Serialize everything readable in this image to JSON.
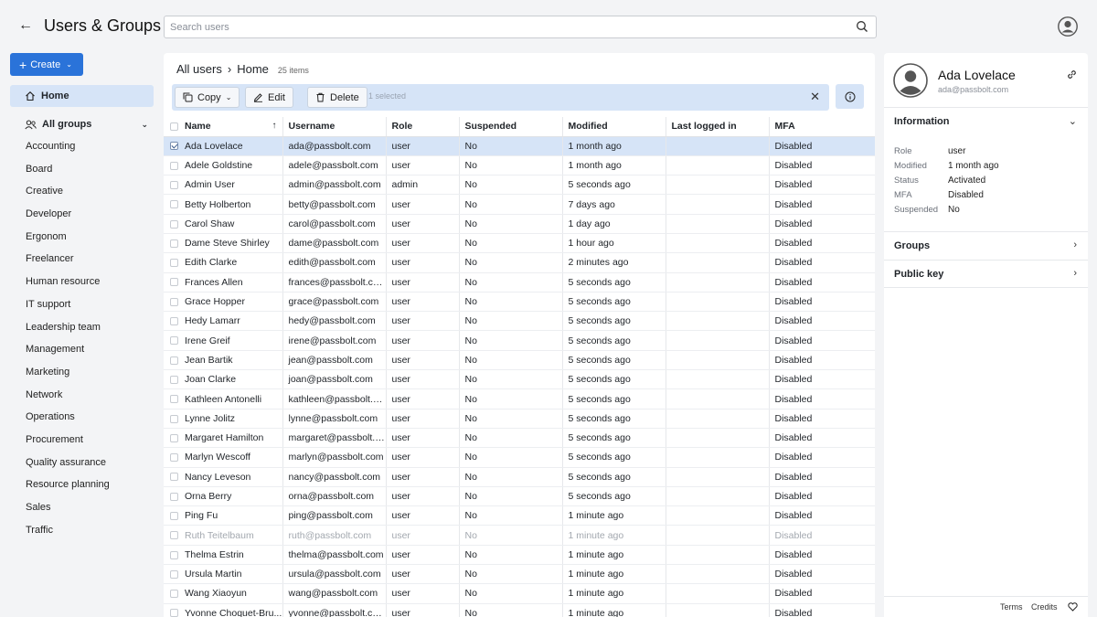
{
  "header": {
    "title": "Users & Groups",
    "search_placeholder": "Search users"
  },
  "sidebar": {
    "create_label": "Create",
    "home_label": "Home",
    "all_groups_label": "All groups",
    "groups": [
      "Accounting",
      "Board",
      "Creative",
      "Developer",
      "Ergonom",
      "Freelancer",
      "Human resource",
      "IT support",
      "Leadership team",
      "Management",
      "Marketing",
      "Network",
      "Operations",
      "Procurement",
      "Quality assurance",
      "Resource planning",
      "Sales",
      "Traffic"
    ]
  },
  "breadcrumb": {
    "root": "All users",
    "separator": "›",
    "current": "Home",
    "count": "25 items"
  },
  "actions": {
    "copy": "Copy",
    "edit": "Edit",
    "delete": "Delete",
    "selected": "1 selected"
  },
  "table": {
    "columns": [
      "Name",
      "Username",
      "Role",
      "Suspended",
      "Modified",
      "Last logged in",
      "MFA"
    ],
    "rows": [
      {
        "name": "Ada Lovelace",
        "username": "ada@passbolt.com",
        "role": "user",
        "suspended": "No",
        "modified": "1 month ago",
        "last": "",
        "mfa": "Disabled",
        "selected": true
      },
      {
        "name": "Adele Goldstine",
        "username": "adele@passbolt.com",
        "role": "user",
        "suspended": "No",
        "modified": "1 month ago",
        "last": "",
        "mfa": "Disabled"
      },
      {
        "name": "Admin User",
        "username": "admin@passbolt.com",
        "role": "admin",
        "suspended": "No",
        "modified": "5 seconds ago",
        "last": "",
        "mfa": "Disabled"
      },
      {
        "name": "Betty Holberton",
        "username": "betty@passbolt.com",
        "role": "user",
        "suspended": "No",
        "modified": "7 days ago",
        "last": "",
        "mfa": "Disabled"
      },
      {
        "name": "Carol Shaw",
        "username": "carol@passbolt.com",
        "role": "user",
        "suspended": "No",
        "modified": "1 day ago",
        "last": "",
        "mfa": "Disabled"
      },
      {
        "name": "Dame Steve Shirley",
        "username": "dame@passbolt.com",
        "role": "user",
        "suspended": "No",
        "modified": "1 hour ago",
        "last": "",
        "mfa": "Disabled"
      },
      {
        "name": "Edith Clarke",
        "username": "edith@passbolt.com",
        "role": "user",
        "suspended": "No",
        "modified": "2 minutes ago",
        "last": "",
        "mfa": "Disabled"
      },
      {
        "name": "Frances Allen",
        "username": "frances@passbolt.com",
        "role": "user",
        "suspended": "No",
        "modified": "5 seconds ago",
        "last": "",
        "mfa": "Disabled"
      },
      {
        "name": "Grace Hopper",
        "username": "grace@passbolt.com",
        "role": "user",
        "suspended": "No",
        "modified": "5 seconds ago",
        "last": "",
        "mfa": "Disabled"
      },
      {
        "name": "Hedy Lamarr",
        "username": "hedy@passbolt.com",
        "role": "user",
        "suspended": "No",
        "modified": "5 seconds ago",
        "last": "",
        "mfa": "Disabled"
      },
      {
        "name": "Irene Greif",
        "username": "irene@passbolt.com",
        "role": "user",
        "suspended": "No",
        "modified": "5 seconds ago",
        "last": "",
        "mfa": "Disabled"
      },
      {
        "name": "Jean Bartik",
        "username": "jean@passbolt.com",
        "role": "user",
        "suspended": "No",
        "modified": "5 seconds ago",
        "last": "",
        "mfa": "Disabled"
      },
      {
        "name": "Joan Clarke",
        "username": "joan@passbolt.com",
        "role": "user",
        "suspended": "No",
        "modified": "5 seconds ago",
        "last": "",
        "mfa": "Disabled"
      },
      {
        "name": "Kathleen Antonelli",
        "username": "kathleen@passbolt.c...",
        "role": "user",
        "suspended": "No",
        "modified": "5 seconds ago",
        "last": "",
        "mfa": "Disabled"
      },
      {
        "name": "Lynne Jolitz",
        "username": "lynne@passbolt.com",
        "role": "user",
        "suspended": "No",
        "modified": "5 seconds ago",
        "last": "",
        "mfa": "Disabled"
      },
      {
        "name": "Margaret Hamilton",
        "username": "margaret@passbolt.c...",
        "role": "user",
        "suspended": "No",
        "modified": "5 seconds ago",
        "last": "",
        "mfa": "Disabled"
      },
      {
        "name": "Marlyn Wescoff",
        "username": "marlyn@passbolt.com",
        "role": "user",
        "suspended": "No",
        "modified": "5 seconds ago",
        "last": "",
        "mfa": "Disabled"
      },
      {
        "name": "Nancy Leveson",
        "username": "nancy@passbolt.com",
        "role": "user",
        "suspended": "No",
        "modified": "5 seconds ago",
        "last": "",
        "mfa": "Disabled"
      },
      {
        "name": "Orna Berry",
        "username": "orna@passbolt.com",
        "role": "user",
        "suspended": "No",
        "modified": "5 seconds ago",
        "last": "",
        "mfa": "Disabled"
      },
      {
        "name": "Ping Fu",
        "username": "ping@passbolt.com",
        "role": "user",
        "suspended": "No",
        "modified": "1 minute ago",
        "last": "",
        "mfa": "Disabled"
      },
      {
        "name": "Ruth Teitelbaum",
        "username": "ruth@passbolt.com",
        "role": "user",
        "suspended": "No",
        "modified": "1 minute ago",
        "last": "",
        "mfa": "Disabled",
        "dimmed": true
      },
      {
        "name": "Thelma Estrin",
        "username": "thelma@passbolt.com",
        "role": "user",
        "suspended": "No",
        "modified": "1 minute ago",
        "last": "",
        "mfa": "Disabled"
      },
      {
        "name": "Ursula Martin",
        "username": "ursula@passbolt.com",
        "role": "user",
        "suspended": "No",
        "modified": "1 minute ago",
        "last": "",
        "mfa": "Disabled"
      },
      {
        "name": "Wang Xiaoyun",
        "username": "wang@passbolt.com",
        "role": "user",
        "suspended": "No",
        "modified": "1 minute ago",
        "last": "",
        "mfa": "Disabled"
      },
      {
        "name": "Yvonne Choquet-Bru...",
        "username": "yvonne@passbolt.com",
        "role": "user",
        "suspended": "No",
        "modified": "1 minute ago",
        "last": "",
        "mfa": "Disabled"
      }
    ]
  },
  "details": {
    "name": "Ada Lovelace",
    "email": "ada@passbolt.com",
    "information_label": "Information",
    "fields": [
      {
        "key": "Role",
        "value": "user"
      },
      {
        "key": "Modified",
        "value": "1 month ago"
      },
      {
        "key": "Status",
        "value": "Activated"
      },
      {
        "key": "MFA",
        "value": "Disabled"
      },
      {
        "key": "Suspended",
        "value": "No"
      }
    ],
    "groups_label": "Groups",
    "public_key_label": "Public key"
  },
  "footer": {
    "terms": "Terms",
    "credits": "Credits"
  },
  "colors": {
    "accent": "#2a73d9",
    "selection": "#d6e4f7"
  }
}
